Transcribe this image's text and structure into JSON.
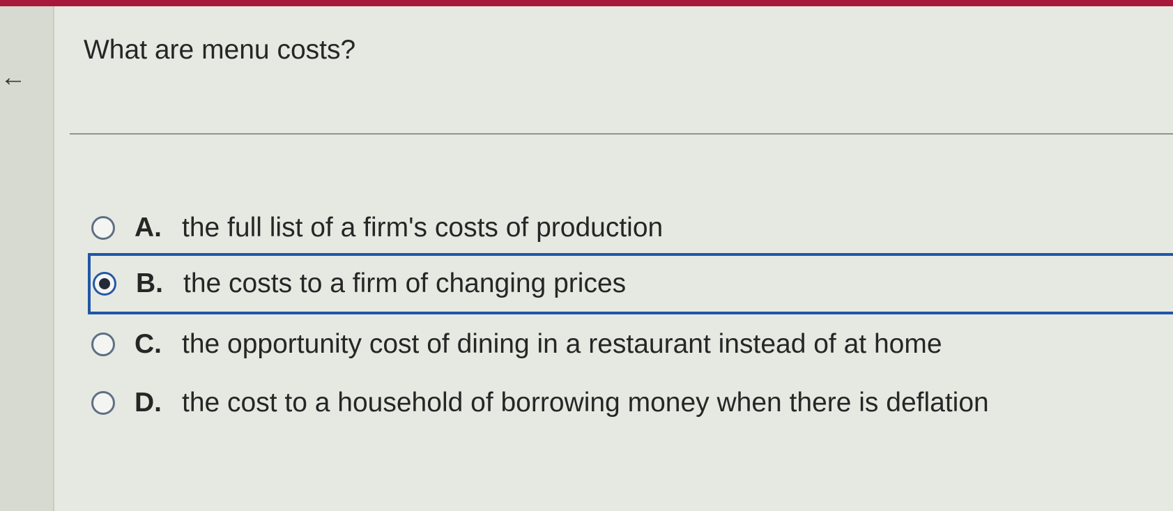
{
  "question": {
    "text": "What are menu costs?"
  },
  "options": [
    {
      "letter": "A.",
      "text": "the full list of a firm's costs of production",
      "selected": false
    },
    {
      "letter": "B.",
      "text": "the costs to a firm of changing prices",
      "selected": true
    },
    {
      "letter": "C.",
      "text": "the opportunity cost of dining in a restaurant instead of at home",
      "selected": false
    },
    {
      "letter": "D.",
      "text": "the cost to a household of borrowing money when there is deflation",
      "selected": false
    }
  ],
  "icons": {
    "back": "back-arrow-icon"
  },
  "colors": {
    "header_bar": "#a8183a",
    "selection_border": "#1f56a8",
    "background": "#e6e9e1"
  }
}
